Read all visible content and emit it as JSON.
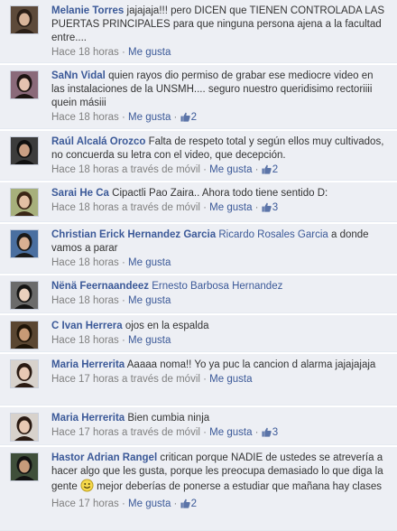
{
  "comments": [
    {
      "author": "Melanie Torres",
      "segments": [
        {
          "type": "text",
          "text": " jajajaja!!! pero DICEN que TIENEN CONTROLADA LAS PUERTAS PRINCIPALES para que ninguna persona ajena a la facultad entre...."
        }
      ],
      "time": "Hace 18 horas",
      "via": "",
      "like_label": "Me gusta",
      "like_count": "",
      "avatar": {
        "bg": "#5d4a3a",
        "skin": "#d8b49a",
        "hair": "#2a1e16"
      }
    },
    {
      "author": "SaNn Vidal",
      "segments": [
        {
          "type": "text",
          "text": " quien rayos dio permiso de grabar ese mediocre video en las instalaciones de la UNSMH.... seguro nuestro queridisimo rectoriiii quein mási​ii"
        }
      ],
      "time": "Hace 18 horas",
      "via": "",
      "like_label": "Me gusta",
      "like_count": "2",
      "avatar": {
        "bg": "#8a6a7a",
        "skin": "#e5c2b0",
        "hair": "#1c1412"
      }
    },
    {
      "author": "Raúl Alcalá Orozco",
      "segments": [
        {
          "type": "text",
          "text": " Falta de respeto total y según ellos muy cultivados, no concuerda su letra con el video, que decepción."
        }
      ],
      "time": "Hace 18 horas",
      "via": "a través de móvil",
      "like_label": "Me gusta",
      "like_count": "2",
      "avatar": {
        "bg": "#3c3c3c",
        "skin": "#c99f84",
        "hair": "#101010"
      }
    },
    {
      "author": "Sarai He Ca",
      "segments": [
        {
          "type": "text",
          "text": " Cipactli Pao Zaira.. Ahora todo tiene sentido D:"
        }
      ],
      "time": "Hace 18 horas",
      "via": "a través de móvil",
      "like_label": "Me gusta",
      "like_count": "3",
      "avatar": {
        "bg": "#a7b07c",
        "skin": "#e2c0a4",
        "hair": "#3a2616"
      }
    },
    {
      "author": "Christian Erick Hernandez Garcia",
      "segments": [
        {
          "type": "text",
          "text": " "
        },
        {
          "type": "tag",
          "text": "Ricardo Rosales Garcia"
        },
        {
          "type": "text",
          "text": " a donde vamos a parar"
        }
      ],
      "time": "Hace 18 horas",
      "via": "",
      "like_label": "Me gusta",
      "like_count": "",
      "avatar": {
        "bg": "#4a6fa0",
        "skin": "#d9b092",
        "hair": "#1a1a1a"
      }
    },
    {
      "author": "Nënä Feernaandeez",
      "segments": [
        {
          "type": "text",
          "text": " "
        },
        {
          "type": "tag",
          "text": "Ernesto Barbosa Hernandez"
        }
      ],
      "time": "Hace 18 horas",
      "via": "",
      "like_label": "Me gusta",
      "like_count": "",
      "avatar": {
        "bg": "#6b6b6b",
        "skin": "#ead0bd",
        "hair": "#141414"
      }
    },
    {
      "author": "C Ivan Herrera",
      "segments": [
        {
          "type": "text",
          "text": " ojos en la espalda"
        }
      ],
      "time": "Hace 18 horas",
      "via": "",
      "like_label": "Me gusta",
      "like_count": "",
      "avatar": {
        "bg": "#5a4632",
        "skin": "#c89a76",
        "hair": "#1e1408"
      }
    },
    {
      "author": "Maria Herrerita",
      "segments": [
        {
          "type": "text",
          "text": " Aaaaa noma!! Yo ya puc la cancion d alarma jajajajaja"
        }
      ],
      "time": "Hace 17 horas",
      "via": "a través de móvil",
      "like_label": "Me gusta",
      "like_count": "",
      "avatar": {
        "bg": "#d8d2cc",
        "skin": "#e8c9b4",
        "hair": "#2a1a12"
      }
    },
    {
      "author": "Maria Herrerita",
      "segments": [
        {
          "type": "text",
          "text": " Bien cumbia ninja"
        }
      ],
      "time": "Hace 17 horas",
      "via": "a través de móvil",
      "like_label": "Me gusta",
      "like_count": "3",
      "avatar": {
        "bg": "#d8d2cc",
        "skin": "#e8c9b4",
        "hair": "#2a1a12"
      }
    },
    {
      "author": "Hastor Adrian Rangel",
      "segments": [
        {
          "type": "text",
          "text": " critican porque NADIE de ustedes se atrevería a hacer algo que les gusta, porque les preocupa demasiado lo que diga la gente "
        },
        {
          "type": "emoji",
          "text": "smile-emoticon"
        },
        {
          "type": "text",
          "text": " mejor deberías de ponerse a estudiar que mañana hay clases"
        }
      ],
      "time": "Hace 17 horas",
      "via": "",
      "like_label": "Me gusta",
      "like_count": "2",
      "avatar": {
        "bg": "#3f4f3a",
        "skin": "#c79b7a",
        "hair": "#121212"
      }
    }
  ],
  "separator": " · ",
  "colors": {
    "link": "#3b5998",
    "meta": "#808080",
    "panel": "#edeff4",
    "text": "#333333"
  }
}
